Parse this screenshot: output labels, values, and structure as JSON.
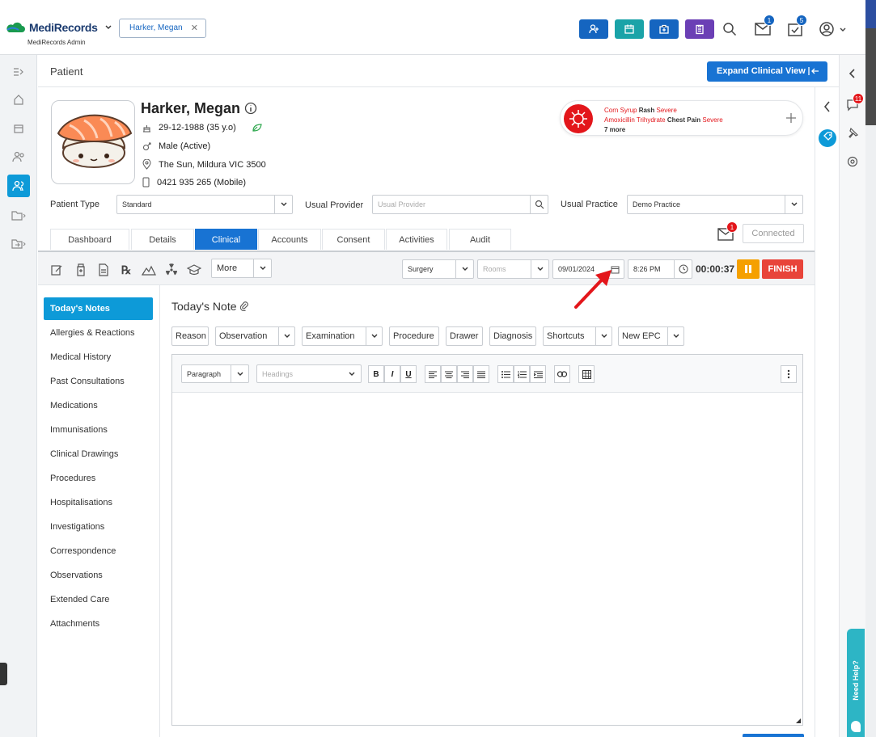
{
  "app": {
    "brand": "MediRecords",
    "brand_sub": "MediRecords Admin"
  },
  "topbar": {
    "patient_chip": "Harker, Megan",
    "mail_badge": "1",
    "tasks_badge": "5"
  },
  "header": {
    "title": "Patient",
    "expand_button": "Expand Clinical View"
  },
  "patient": {
    "name": "Harker, Megan",
    "dob": "29-12-1988 (35 y.o)",
    "gender": "Male (Active)",
    "address": "The Sun, Mildura VIC 3500",
    "phone": "0421 935 265 (Mobile)"
  },
  "allergies": {
    "items": [
      {
        "substance": "Corn Syrup",
        "reaction": "Rash",
        "severity": "Severe"
      },
      {
        "substance": "Amoxicillin Trihydrate",
        "reaction": "Chest Pain",
        "severity": "Severe"
      }
    ],
    "more": "7 more"
  },
  "fields": {
    "patient_type_label": "Patient Type",
    "patient_type_value": "Standard",
    "usual_provider_label": "Usual Provider",
    "usual_provider_placeholder": "Usual Provider",
    "usual_practice_label": "Usual Practice",
    "usual_practice_value": "Demo Practice"
  },
  "tabs": [
    "Dashboard",
    "Details",
    "Clinical",
    "Accounts",
    "Consent",
    "Activities",
    "Audit"
  ],
  "messages": {
    "badge": "1",
    "connected": "Connected"
  },
  "toolbar": {
    "more": "More",
    "location": "Surgery",
    "rooms_placeholder": "Rooms",
    "date": "09/01/2024",
    "time": "8:26 PM",
    "timer": "00:00:37",
    "finish": "FINISH"
  },
  "nav": [
    "Today's Notes",
    "Allergies & Reactions",
    "Medical History",
    "Past Consultations",
    "Medications",
    "Immunisations",
    "Clinical Drawings",
    "Procedures",
    "Hospitalisations",
    "Investigations",
    "Correspondence",
    "Observations",
    "Extended Care",
    "Attachments"
  ],
  "note": {
    "title": "Today's Note",
    "buttons": [
      "Reason",
      "Observation",
      "Examination",
      "Procedure",
      "Drawer",
      "Diagnosis",
      "Shortcuts",
      "New EPC"
    ],
    "paragraph": "Paragraph",
    "headings_placeholder": "Headings"
  },
  "right_panel": {
    "notif_badge": "11"
  },
  "help": "Need Help?",
  "colors": {
    "primary": "#1873d3",
    "accent": "#0d9ad8",
    "finish": "#e8443a",
    "pause": "#f5a000",
    "teal": "#2db5c5"
  }
}
